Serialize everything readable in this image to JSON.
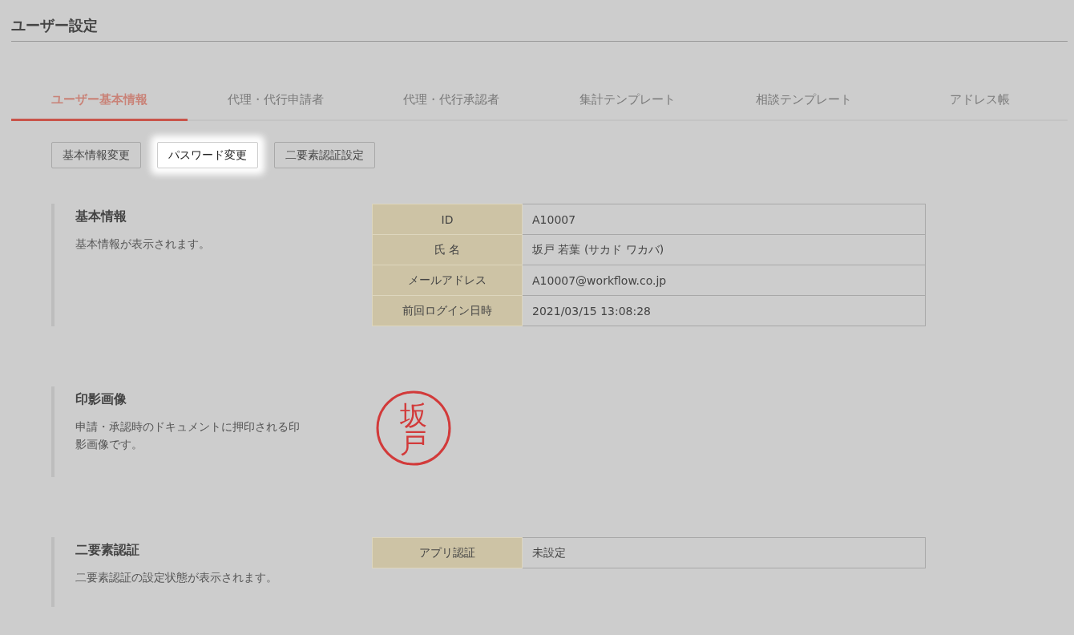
{
  "page_title": "ユーザー設定",
  "tabs": [
    {
      "label": "ユーザー基本情報",
      "selected": true
    },
    {
      "label": "代理・代行申請者",
      "selected": false
    },
    {
      "label": "代理・代行承認者",
      "selected": false
    },
    {
      "label": "集計テンプレート",
      "selected": false
    },
    {
      "label": "相談テンプレート",
      "selected": false
    },
    {
      "label": "アドレス帳",
      "selected": false
    }
  ],
  "buttons": [
    {
      "label": "基本情報変更",
      "highlighted": false
    },
    {
      "label": "パスワード変更",
      "highlighted": true
    },
    {
      "label": "二要素認証設定",
      "highlighted": false
    }
  ],
  "sections": [
    {
      "kind": "table",
      "title": "基本情報",
      "description": "基本情報が表示されます。",
      "rows": [
        {
          "label": "ID",
          "value": "A10007"
        },
        {
          "label": "氏 名",
          "value": "坂戸 若葉 (サカド ワカバ)"
        },
        {
          "label": "メールアドレス",
          "value": "A10007@workflow.co.jp"
        },
        {
          "label": "前回ログイン日時",
          "value": "2021/03/15 13:08:28"
        }
      ]
    },
    {
      "kind": "seal",
      "title": "印影画像",
      "description": "申請・承認時のドキュメントに押印される印影画像です。",
      "seal_text": "坂戸"
    },
    {
      "kind": "table",
      "title": "二要素認証",
      "description": "二要素認証の設定状態が表示されます。",
      "rows": [
        {
          "label": "アプリ認証",
          "value": "未設定"
        }
      ]
    }
  ]
}
